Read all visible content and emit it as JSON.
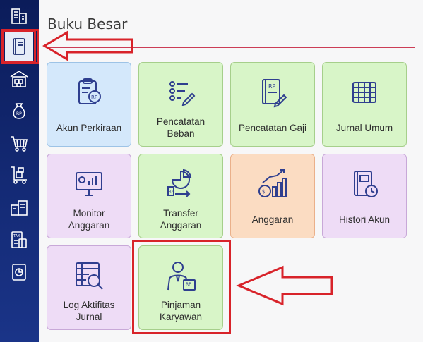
{
  "panel": {
    "title": "Buku Besar"
  },
  "sidebar": {
    "items": [
      {
        "icon": "building-icon",
        "selected": false
      },
      {
        "icon": "ledger-book-icon",
        "selected": true
      },
      {
        "icon": "warehouse-icon",
        "selected": false
      },
      {
        "icon": "money-bag-icon",
        "selected": false
      },
      {
        "icon": "shopping-cart-icon",
        "selected": false
      },
      {
        "icon": "delivery-cart-icon",
        "selected": false
      },
      {
        "icon": "office-chart-icon",
        "selected": false
      },
      {
        "icon": "tax-document-icon",
        "selected": false
      },
      {
        "icon": "report-chart-icon",
        "selected": false
      }
    ]
  },
  "tiles": [
    {
      "label": "Akun Perkiraan",
      "icon": "clipboard-rp-icon",
      "color": "#d4e8fb"
    },
    {
      "label": "Pencatatan\nBeban",
      "icon": "checklist-edit-icon",
      "color": "#d8f5c8"
    },
    {
      "label": "Pencatatan Gaji",
      "icon": "rp-book-edit-icon",
      "color": "#d8f5c8"
    },
    {
      "label": "Jurnal Umum",
      "icon": "grid-table-icon",
      "color": "#d8f5c8"
    },
    {
      "label": "Monitor\nAnggaran",
      "icon": "monitor-chart-icon",
      "color": "#eedcf6"
    },
    {
      "label": "Transfer\nAnggaran",
      "icon": "pie-transfer-icon",
      "color": "#d8f5c8"
    },
    {
      "label": "Anggaran",
      "icon": "coins-growth-icon",
      "color": "#fbdcc2"
    },
    {
      "label": "Histori Akun",
      "icon": "history-book-icon",
      "color": "#eedcf6"
    },
    {
      "label": "Log Aktifitas\nJurnal",
      "icon": "table-search-icon",
      "color": "#eedcf6"
    },
    {
      "label": "Pinjaman\nKaryawan",
      "icon": "employee-loan-icon",
      "color": "#d8f5c8"
    }
  ],
  "colors": {
    "annotation": "#d8232a",
    "rule": "#cc3d56",
    "icon_stroke": "#2f3f8f"
  }
}
